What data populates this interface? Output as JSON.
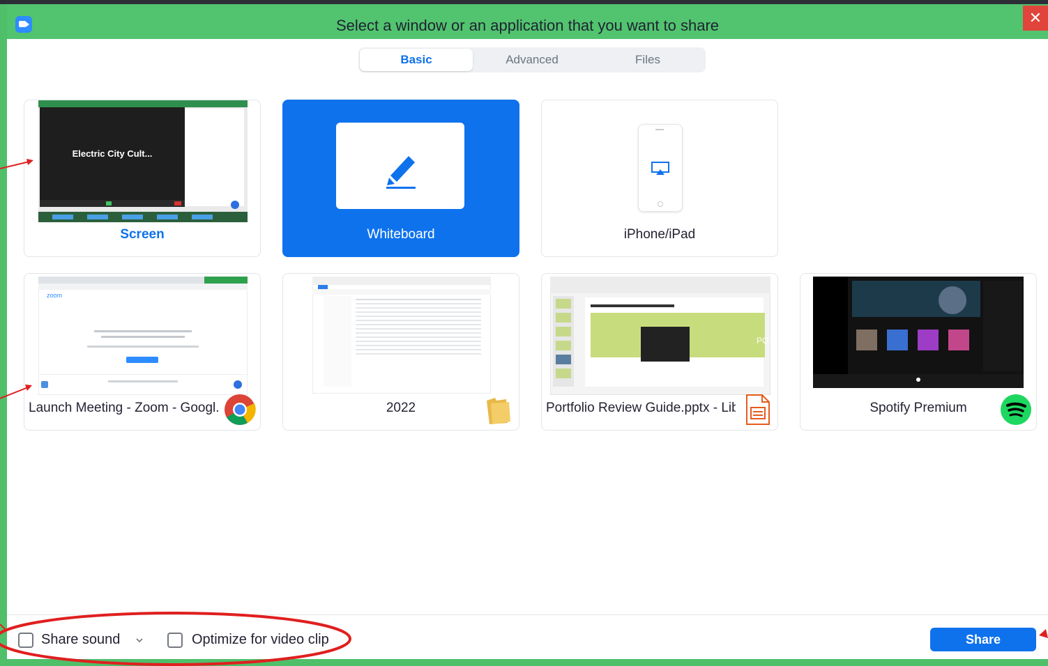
{
  "window": {
    "title": "Select a window or an application that you want to share",
    "close_label": "✕"
  },
  "tabs": [
    {
      "label": "Basic",
      "active": true
    },
    {
      "label": "Advanced",
      "active": false
    },
    {
      "label": "Files",
      "active": false
    }
  ],
  "cards": [
    {
      "label": "Screen",
      "selected": false,
      "thumb_text": "Electric City Cult..."
    },
    {
      "label": "Whiteboard",
      "selected": true
    },
    {
      "label": "iPhone/iPad",
      "selected": false
    },
    {
      "label": "Launch Meeting - Zoom - Googl...",
      "selected": false,
      "thumb_text": "zoom"
    },
    {
      "label": "2022",
      "selected": false
    },
    {
      "label": "Portfolio Review Guide.pptx - Lib...",
      "selected": false,
      "thumb_text": "PO:"
    },
    {
      "label": "Spotify Premium",
      "selected": false
    }
  ],
  "footer": {
    "share_sound_label": "Share sound",
    "dropdown_icon": "chevron-down-icon",
    "optimize_label": "Optimize for video clip",
    "share_button_label": "Share"
  },
  "colors": {
    "title_bar": "#52c36f",
    "accent": "#0e72ed",
    "annotation": "#e01f1f"
  }
}
